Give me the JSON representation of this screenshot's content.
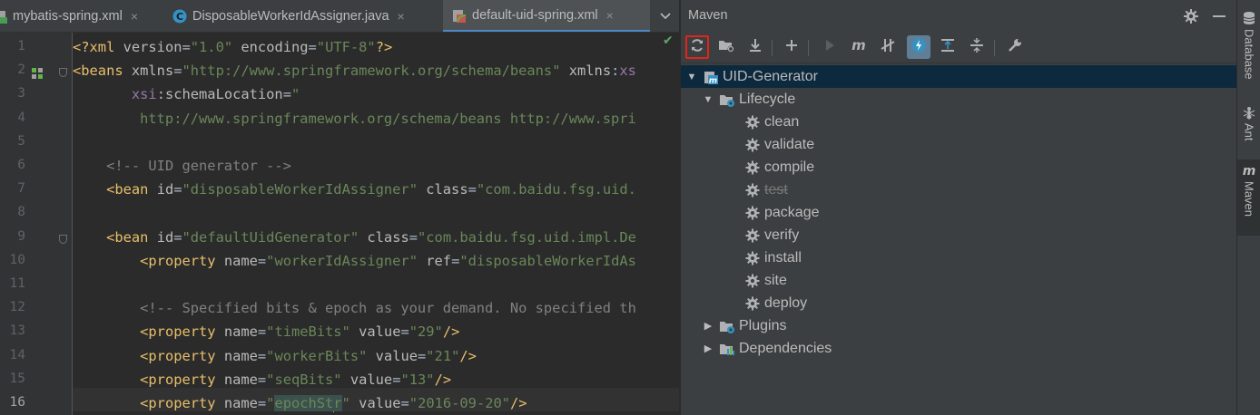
{
  "editor": {
    "tabs": [
      {
        "label": "mybatis-spring.xml",
        "icon": "xml-file-icon",
        "close": "×",
        "active": false
      },
      {
        "label": "DisposableWorkerIdAssigner.java",
        "icon": "java-class-icon",
        "close": "×",
        "active": false
      },
      {
        "label": "default-uid-spring.xml",
        "icon": "spring-xml-icon",
        "close": "×",
        "active": true
      }
    ],
    "tabs_menu_icon": "chevron-down-icon",
    "inspection_status": "✔",
    "line_numbers": [
      "1",
      "2",
      "3",
      "4",
      "5",
      "6",
      "7",
      "8",
      "9",
      "10",
      "11",
      "12",
      "13",
      "14",
      "15",
      "16"
    ],
    "current_line": "16",
    "lines": [
      [
        {
          "t": "tag",
          "s": "<?xml "
        },
        {
          "t": "attr",
          "s": "version"
        },
        {
          "t": "pl",
          "s": "="
        },
        {
          "t": "val",
          "s": "\"1.0\""
        },
        {
          "t": "pl",
          "s": " "
        },
        {
          "t": "attr",
          "s": "encoding"
        },
        {
          "t": "pl",
          "s": "="
        },
        {
          "t": "val",
          "s": "\"UTF-8\""
        },
        {
          "t": "tag",
          "s": "?>"
        }
      ],
      [
        {
          "t": "tag",
          "s": "<beans "
        },
        {
          "t": "attr",
          "s": "xmlns"
        },
        {
          "t": "pl",
          "s": "="
        },
        {
          "t": "val",
          "s": "\"http://www.springframework.org/schema/beans\""
        },
        {
          "t": "pl",
          "s": " "
        },
        {
          "t": "attr",
          "s": "xmlns"
        },
        {
          "t": "pl",
          "s": ":"
        },
        {
          "t": "ns",
          "s": "xs"
        }
      ],
      [
        {
          "t": "pl",
          "s": "       "
        },
        {
          "t": "ns",
          "s": "xsi"
        },
        {
          "t": "pl",
          "s": ":"
        },
        {
          "t": "attr",
          "s": "schemaLocation"
        },
        {
          "t": "pl",
          "s": "="
        },
        {
          "t": "val",
          "s": "\""
        }
      ],
      [
        {
          "t": "val",
          "s": "        http://www.springframework.org/schema/beans http://www.spri"
        }
      ],
      [],
      [
        {
          "t": "pl",
          "s": "    "
        },
        {
          "t": "cmt",
          "s": "<!-- UID generator -->"
        }
      ],
      [
        {
          "t": "pl",
          "s": "    "
        },
        {
          "t": "tag",
          "s": "<bean "
        },
        {
          "t": "attr",
          "s": "id"
        },
        {
          "t": "pl",
          "s": "="
        },
        {
          "t": "val",
          "s": "\"disposableWorkerIdAssigner\""
        },
        {
          "t": "pl",
          "s": " "
        },
        {
          "t": "attr",
          "s": "class"
        },
        {
          "t": "pl",
          "s": "="
        },
        {
          "t": "val",
          "s": "\"com.baidu.fsg.uid."
        }
      ],
      [],
      [
        {
          "t": "pl",
          "s": "    "
        },
        {
          "t": "tag",
          "s": "<bean "
        },
        {
          "t": "attr",
          "s": "id"
        },
        {
          "t": "pl",
          "s": "="
        },
        {
          "t": "val",
          "s": "\"defaultUidGenerator\""
        },
        {
          "t": "pl",
          "s": " "
        },
        {
          "t": "attr",
          "s": "class"
        },
        {
          "t": "pl",
          "s": "="
        },
        {
          "t": "val",
          "s": "\"com.baidu.fsg.uid.impl.De"
        }
      ],
      [
        {
          "t": "pl",
          "s": "        "
        },
        {
          "t": "tag",
          "s": "<property "
        },
        {
          "t": "attr",
          "s": "name"
        },
        {
          "t": "pl",
          "s": "="
        },
        {
          "t": "val",
          "s": "\"workerIdAssigner\""
        },
        {
          "t": "pl",
          "s": " "
        },
        {
          "t": "attr",
          "s": "ref"
        },
        {
          "t": "pl",
          "s": "="
        },
        {
          "t": "val",
          "s": "\"disposableWorkerIdAs"
        }
      ],
      [],
      [
        {
          "t": "pl",
          "s": "        "
        },
        {
          "t": "cmt",
          "s": "<!-- Specified bits & epoch as your demand. No specified th"
        }
      ],
      [
        {
          "t": "pl",
          "s": "        "
        },
        {
          "t": "tag",
          "s": "<property "
        },
        {
          "t": "attr",
          "s": "name"
        },
        {
          "t": "pl",
          "s": "="
        },
        {
          "t": "val",
          "s": "\"timeBits\""
        },
        {
          "t": "pl",
          "s": " "
        },
        {
          "t": "attr",
          "s": "value"
        },
        {
          "t": "pl",
          "s": "="
        },
        {
          "t": "val",
          "s": "\"29\""
        },
        {
          "t": "tag",
          "s": "/>"
        }
      ],
      [
        {
          "t": "pl",
          "s": "        "
        },
        {
          "t": "tag",
          "s": "<property "
        },
        {
          "t": "attr",
          "s": "name"
        },
        {
          "t": "pl",
          "s": "="
        },
        {
          "t": "val",
          "s": "\"workerBits\""
        },
        {
          "t": "pl",
          "s": " "
        },
        {
          "t": "attr",
          "s": "value"
        },
        {
          "t": "pl",
          "s": "="
        },
        {
          "t": "val",
          "s": "\"21\""
        },
        {
          "t": "tag",
          "s": "/>"
        }
      ],
      [
        {
          "t": "pl",
          "s": "        "
        },
        {
          "t": "tag",
          "s": "<property "
        },
        {
          "t": "attr",
          "s": "name"
        },
        {
          "t": "pl",
          "s": "="
        },
        {
          "t": "val",
          "s": "\"seqBits\""
        },
        {
          "t": "pl",
          "s": " "
        },
        {
          "t": "attr",
          "s": "value"
        },
        {
          "t": "pl",
          "s": "="
        },
        {
          "t": "val",
          "s": "\"13\""
        },
        {
          "t": "tag",
          "s": "/>"
        }
      ],
      [
        {
          "t": "pl",
          "s": "        "
        },
        {
          "t": "tag",
          "s": "<property "
        },
        {
          "t": "attr",
          "s": "name"
        },
        {
          "t": "pl",
          "s": "="
        },
        {
          "t": "val",
          "s": "\""
        },
        {
          "t": "valhl",
          "s": "epochSt"
        },
        {
          "t": "caret",
          "s": ""
        },
        {
          "t": "valhl",
          "s": "r"
        },
        {
          "t": "val",
          "s": "\""
        },
        {
          "t": "pl",
          "s": " "
        },
        {
          "t": "attr",
          "s": "value"
        },
        {
          "t": "pl",
          "s": "="
        },
        {
          "t": "val",
          "s": "\"2016-09-20\""
        },
        {
          "t": "tag",
          "s": "/>"
        }
      ]
    ]
  },
  "maven": {
    "title": "Maven",
    "header_icons": [
      "gear-icon",
      "minimize-icon"
    ],
    "toolbar": [
      {
        "name": "reload-all-maven-projects-button",
        "icon": "reload-icon",
        "highlighted": true
      },
      {
        "name": "generate-sources-button",
        "icon": "folder-reload-icon"
      },
      {
        "name": "download-sources-button",
        "icon": "download-icon"
      },
      {
        "name": "add-maven-project-button",
        "icon": "plus-icon"
      },
      {
        "name": "run-maven-build-button",
        "icon": "run-icon",
        "disabled": true
      },
      {
        "name": "execute-maven-goal-button",
        "icon": "maven-m-icon"
      },
      {
        "name": "toggle-offline-mode-button",
        "icon": "offline-icon"
      },
      {
        "name": "skip-tests-button",
        "icon": "lightning-icon",
        "toggled": true
      },
      {
        "name": "show-dependencies-button",
        "icon": "expand-all-icon"
      },
      {
        "name": "collapse-all-button",
        "icon": "collapse-all-icon"
      },
      {
        "name": "maven-settings-button",
        "icon": "wrench-icon"
      }
    ],
    "tree": [
      {
        "label": "UID-Generator",
        "level": 0,
        "arrow": "▼",
        "icon": "maven-module-icon",
        "selected": true
      },
      {
        "label": "Lifecycle",
        "level": 1,
        "arrow": "▼",
        "icon": "lifecycle-folder-icon"
      },
      {
        "label": "clean",
        "level": 2,
        "icon": "gear-icon"
      },
      {
        "label": "validate",
        "level": 2,
        "icon": "gear-icon"
      },
      {
        "label": "compile",
        "level": 2,
        "icon": "gear-icon"
      },
      {
        "label": "test",
        "level": 2,
        "icon": "gear-icon",
        "disabled": true
      },
      {
        "label": "package",
        "level": 2,
        "icon": "gear-icon"
      },
      {
        "label": "verify",
        "level": 2,
        "icon": "gear-icon"
      },
      {
        "label": "install",
        "level": 2,
        "icon": "gear-icon"
      },
      {
        "label": "site",
        "level": 2,
        "icon": "gear-icon"
      },
      {
        "label": "deploy",
        "level": 2,
        "icon": "gear-icon"
      },
      {
        "label": "Plugins",
        "level": 1,
        "arrow": "▶",
        "icon": "plugins-folder-icon"
      },
      {
        "label": "Dependencies",
        "level": 1,
        "arrow": "▶",
        "icon": "dependencies-folder-icon"
      }
    ]
  },
  "tool_strip": [
    {
      "label": "Database",
      "icon": "database-icon"
    },
    {
      "label": "Ant",
      "icon": "ant-icon"
    },
    {
      "label": "Maven",
      "icon": "maven-m-icon",
      "active": true
    }
  ],
  "colors": {
    "accent": "#4a88c7",
    "highlight_box": "#e0251a",
    "selection": "#0d293e"
  }
}
